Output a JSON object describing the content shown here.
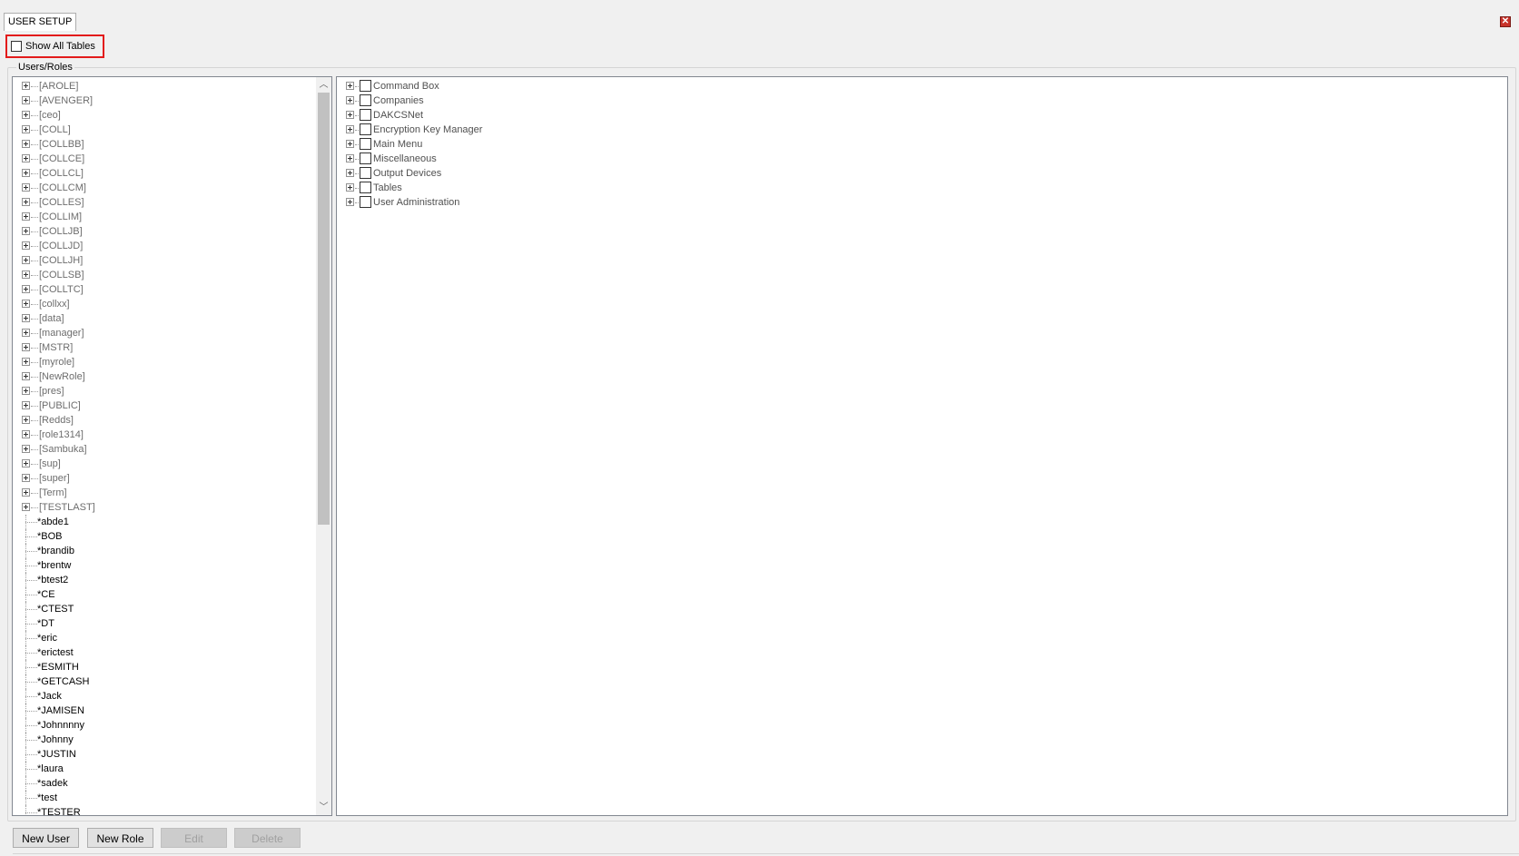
{
  "window": {
    "tab_title": "USER SETUP",
    "close_icon": "close-icon"
  },
  "options": {
    "show_all_tables_label": "Show All Tables",
    "show_all_tables_checked": false
  },
  "users_roles": {
    "caption": "Users/Roles",
    "roles": [
      "[AROLE]",
      "[AVENGER]",
      "[ceo]",
      "[COLL]",
      "[COLLBB]",
      "[COLLCE]",
      "[COLLCL]",
      "[COLLCM]",
      "[COLLES]",
      "[COLLIM]",
      "[COLLJB]",
      "[COLLJD]",
      "[COLLJH]",
      "[COLLSB]",
      "[COLLTC]",
      "[collxx]",
      "[data]",
      "[manager]",
      "[MSTR]",
      "[myrole]",
      "[NewRole]",
      "[pres]",
      "[PUBLIC]",
      "[Redds]",
      "[role1314]",
      "[Sambuka]",
      "[sup]",
      "[super]",
      "[Term]",
      "[TESTLAST]"
    ],
    "users": [
      "*abde1",
      "*BOB",
      "*brandib",
      "*brentw",
      "*btest2",
      "*CE",
      "*CTEST",
      "*DT",
      "*eric",
      "*erictest",
      "*ESMITH",
      "*GETCASH",
      "*Jack",
      "*JAMISEN",
      "*Johnnnny",
      "*Johnny",
      "*JUSTIN",
      "*laura",
      "*sadek",
      "*test",
      "*TESTER"
    ]
  },
  "permissions": {
    "items": [
      "Command Box",
      "Companies",
      "DAKCSNet",
      "Encryption Key Manager",
      "Main Menu",
      "Miscellaneous",
      "Output Devices",
      "Tables",
      "User Administration"
    ]
  },
  "buttons": {
    "new_user": "New User",
    "new_role": "New Role",
    "edit": "Edit",
    "delete": "Delete"
  }
}
